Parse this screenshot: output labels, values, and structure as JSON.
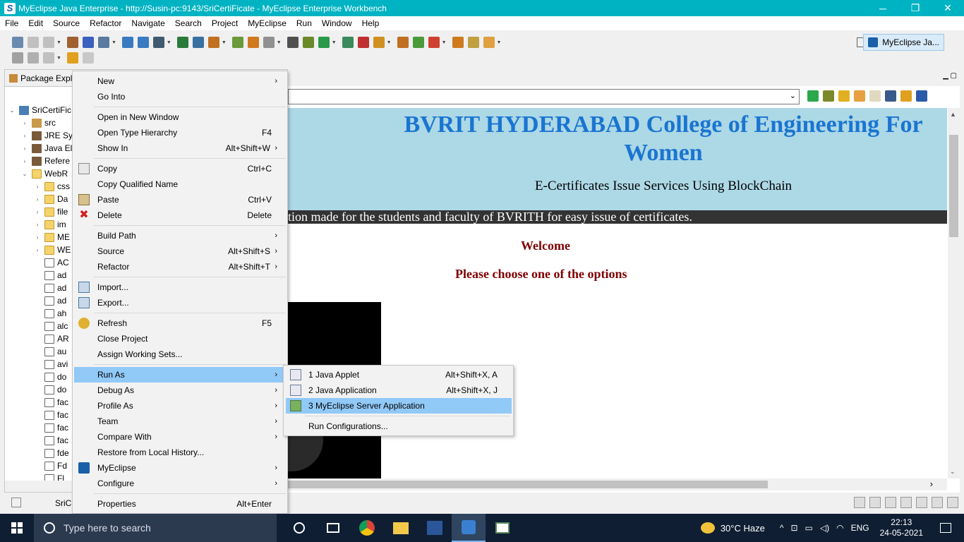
{
  "window": {
    "title": "MyEclipse Java Enterprise - http://Susin-pc:9143/SriCertiFicate - MyEclipse Enterprise Workbench",
    "minimize": "─",
    "maximize": "❐",
    "close": "✕"
  },
  "menubar": [
    "File",
    "Edit",
    "Source",
    "Refactor",
    "Navigate",
    "Search",
    "Project",
    "MyEclipse",
    "Run",
    "Window",
    "Help"
  ],
  "perspective": {
    "label": "MyEclipse Ja..."
  },
  "package_explorer": {
    "tab_label": "Package Explo",
    "tree": [
      {
        "indent": 0,
        "toggle": "⌄",
        "icon": "project",
        "label": "SriCertiFic"
      },
      {
        "indent": 1,
        "toggle": "›",
        "icon": "package",
        "label": "src"
      },
      {
        "indent": 1,
        "toggle": "›",
        "icon": "library",
        "label": "JRE Sy"
      },
      {
        "indent": 1,
        "toggle": "›",
        "icon": "library",
        "label": "Java El"
      },
      {
        "indent": 1,
        "toggle": "›",
        "icon": "library",
        "label": "Refere"
      },
      {
        "indent": 1,
        "toggle": "⌄",
        "icon": "folder",
        "label": "WebR"
      },
      {
        "indent": 2,
        "toggle": "›",
        "icon": "folder",
        "label": "css"
      },
      {
        "indent": 2,
        "toggle": "›",
        "icon": "folder",
        "label": "Da"
      },
      {
        "indent": 2,
        "toggle": "›",
        "icon": "folder",
        "label": "file"
      },
      {
        "indent": 2,
        "toggle": "›",
        "icon": "folder",
        "label": "im"
      },
      {
        "indent": 2,
        "toggle": "›",
        "icon": "folder",
        "label": "ME"
      },
      {
        "indent": 2,
        "toggle": "›",
        "icon": "folder",
        "label": "WE"
      },
      {
        "indent": 2,
        "toggle": "",
        "icon": "jsp",
        "label": "AC"
      },
      {
        "indent": 2,
        "toggle": "",
        "icon": "jsp",
        "label": "ad"
      },
      {
        "indent": 2,
        "toggle": "",
        "icon": "jsp",
        "label": "ad"
      },
      {
        "indent": 2,
        "toggle": "",
        "icon": "jsp",
        "label": "ad"
      },
      {
        "indent": 2,
        "toggle": "",
        "icon": "jsp",
        "label": "ah"
      },
      {
        "indent": 2,
        "toggle": "",
        "icon": "jsp",
        "label": "alc"
      },
      {
        "indent": 2,
        "toggle": "",
        "icon": "jsp",
        "label": "AR"
      },
      {
        "indent": 2,
        "toggle": "",
        "icon": "jsp",
        "label": "au"
      },
      {
        "indent": 2,
        "toggle": "",
        "icon": "jsp",
        "label": "avi"
      },
      {
        "indent": 2,
        "toggle": "",
        "icon": "jsp",
        "label": "do"
      },
      {
        "indent": 2,
        "toggle": "",
        "icon": "jsp",
        "label": "do"
      },
      {
        "indent": 2,
        "toggle": "",
        "icon": "jsp",
        "label": "fac"
      },
      {
        "indent": 2,
        "toggle": "",
        "icon": "jsp",
        "label": "fac"
      },
      {
        "indent": 2,
        "toggle": "",
        "icon": "jsp",
        "label": "fac"
      },
      {
        "indent": 2,
        "toggle": "",
        "icon": "jsp",
        "label": "fac"
      },
      {
        "indent": 2,
        "toggle": "",
        "icon": "jsp",
        "label": "fde"
      },
      {
        "indent": 2,
        "toggle": "",
        "icon": "jsp",
        "label": "Fd"
      },
      {
        "indent": 2,
        "toggle": "",
        "icon": "jsp",
        "label": "Fl"
      }
    ]
  },
  "context_menu": [
    {
      "type": "item",
      "label": "New",
      "shortcut": "",
      "submenu": true,
      "icon": ""
    },
    {
      "type": "item",
      "label": "Go Into",
      "shortcut": "",
      "submenu": false,
      "icon": ""
    },
    {
      "type": "sep"
    },
    {
      "type": "item",
      "label": "Open in New Window",
      "shortcut": "",
      "submenu": false,
      "icon": ""
    },
    {
      "type": "item",
      "label": "Open Type Hierarchy",
      "shortcut": "F4",
      "submenu": false,
      "icon": ""
    },
    {
      "type": "item",
      "label": "Show In",
      "shortcut": "Alt+Shift+W",
      "submenu": true,
      "icon": ""
    },
    {
      "type": "sep"
    },
    {
      "type": "item",
      "label": "Copy",
      "shortcut": "Ctrl+C",
      "submenu": false,
      "icon": "copy-icon"
    },
    {
      "type": "item",
      "label": "Copy Qualified Name",
      "shortcut": "",
      "submenu": false,
      "icon": ""
    },
    {
      "type": "item",
      "label": "Paste",
      "shortcut": "Ctrl+V",
      "submenu": false,
      "icon": "paste-icon"
    },
    {
      "type": "item",
      "label": "Delete",
      "shortcut": "Delete",
      "submenu": false,
      "icon": "delete-icon"
    },
    {
      "type": "sep"
    },
    {
      "type": "item",
      "label": "Build Path",
      "shortcut": "",
      "submenu": true,
      "icon": ""
    },
    {
      "type": "item",
      "label": "Source",
      "shortcut": "Alt+Shift+S",
      "submenu": true,
      "icon": ""
    },
    {
      "type": "item",
      "label": "Refactor",
      "shortcut": "Alt+Shift+T",
      "submenu": true,
      "icon": ""
    },
    {
      "type": "sep"
    },
    {
      "type": "item",
      "label": "Import...",
      "shortcut": "",
      "submenu": false,
      "icon": "import-icon"
    },
    {
      "type": "item",
      "label": "Export...",
      "shortcut": "",
      "submenu": false,
      "icon": "export-icon"
    },
    {
      "type": "sep"
    },
    {
      "type": "item",
      "label": "Refresh",
      "shortcut": "F5",
      "submenu": false,
      "icon": "refresh-icon"
    },
    {
      "type": "item",
      "label": "Close Project",
      "shortcut": "",
      "submenu": false,
      "icon": ""
    },
    {
      "type": "item",
      "label": "Assign Working Sets...",
      "shortcut": "",
      "submenu": false,
      "icon": ""
    },
    {
      "type": "sep"
    },
    {
      "type": "item",
      "label": "Run As",
      "shortcut": "",
      "submenu": true,
      "icon": "",
      "selected": true
    },
    {
      "type": "item",
      "label": "Debug As",
      "shortcut": "",
      "submenu": true,
      "icon": ""
    },
    {
      "type": "item",
      "label": "Profile As",
      "shortcut": "",
      "submenu": true,
      "icon": ""
    },
    {
      "type": "item",
      "label": "Team",
      "shortcut": "",
      "submenu": true,
      "icon": ""
    },
    {
      "type": "item",
      "label": "Compare With",
      "shortcut": "",
      "submenu": true,
      "icon": ""
    },
    {
      "type": "item",
      "label": "Restore from Local History...",
      "shortcut": "",
      "submenu": false,
      "icon": ""
    },
    {
      "type": "item",
      "label": "MyEclipse",
      "shortcut": "",
      "submenu": true,
      "icon": "myeclipse-icon"
    },
    {
      "type": "item",
      "label": "Configure",
      "shortcut": "",
      "submenu": true,
      "icon": ""
    },
    {
      "type": "sep"
    },
    {
      "type": "item",
      "label": "Properties",
      "shortcut": "Alt+Enter",
      "submenu": false,
      "icon": ""
    }
  ],
  "run_as_submenu": [
    {
      "type": "item",
      "label": "1 Java Applet",
      "shortcut": "Alt+Shift+X, A",
      "icon": "applet-icon"
    },
    {
      "type": "item",
      "label": "2 Java Application",
      "shortcut": "Alt+Shift+X, J",
      "icon": "java-app-icon"
    },
    {
      "type": "item",
      "label": "3 MyEclipse Server Application",
      "shortcut": "",
      "icon": "server-app-icon",
      "selected": true
    },
    {
      "type": "sep"
    },
    {
      "type": "item",
      "label": "Run Configurations...",
      "shortcut": "",
      "icon": ""
    }
  ],
  "web_page": {
    "title": "BVRIT HYDERABAD College of Engineering For Women",
    "subtitle": "E-Certificates Issue Services Using BlockChain",
    "marquee": "tion made for the students and faculty of BVRITH for easy issue of certificates.",
    "welcome": "Welcome",
    "choose": "Please choose one of the options"
  },
  "statusbar": {
    "selection": "SriCe"
  },
  "taskbar": {
    "search_placeholder": "Type here to search",
    "weather": "30°C  Haze",
    "language": "ENG",
    "time": "22:13",
    "date": "24-05-2021"
  },
  "colors": {
    "titlebar": "#00b3c2",
    "menu_selection": "#91c9f7",
    "web_header": "#add8e6",
    "web_title": "#1a75d1",
    "web_maroon": "#800000"
  }
}
